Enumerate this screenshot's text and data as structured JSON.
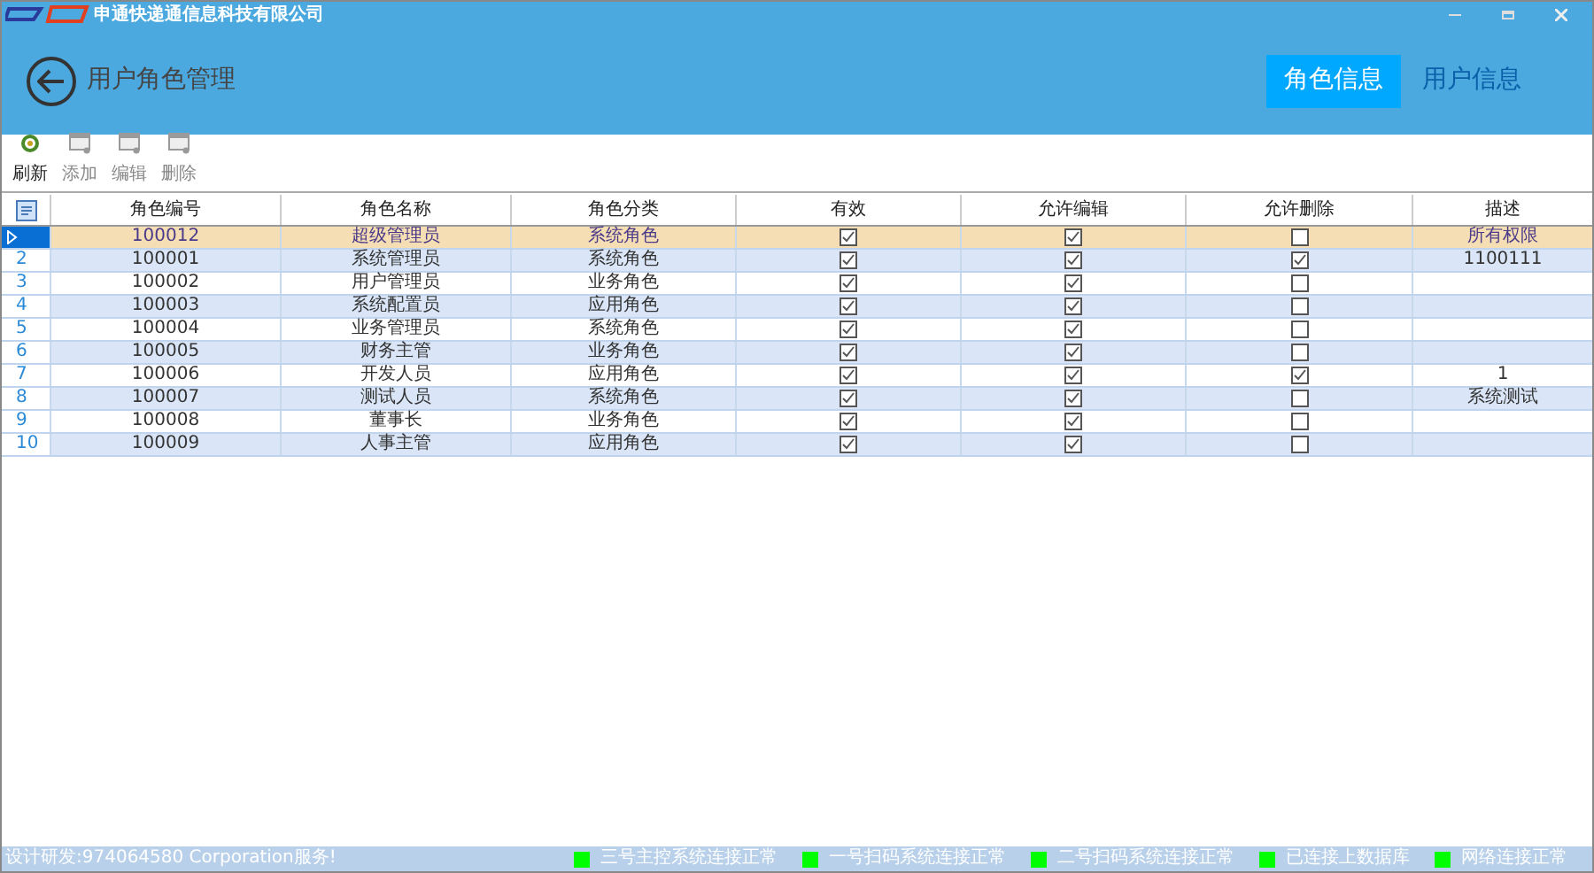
{
  "window": {
    "title": "申通快递通信息科技有限公司"
  },
  "header": {
    "title": "用户角色管理",
    "tabs": [
      {
        "label": "角色信息",
        "selected": true
      },
      {
        "label": "用户信息",
        "selected": false
      }
    ]
  },
  "toolbar": [
    {
      "label": "刷新",
      "kind": "refresh",
      "disabled": false
    },
    {
      "label": "添加",
      "kind": "add",
      "disabled": true
    },
    {
      "label": "编辑",
      "kind": "edit",
      "disabled": true
    },
    {
      "label": "删除",
      "kind": "delete",
      "disabled": true
    }
  ],
  "table": {
    "columns": [
      "角色编号",
      "角色名称",
      "角色分类",
      "有效",
      "允许编辑",
      "允许删除",
      "描述"
    ],
    "rows": [
      {
        "row_number": "",
        "selected": true,
        "id": "100012",
        "name": "超级管理员",
        "category": "系统角色",
        "valid": true,
        "editable": true,
        "deletable": false,
        "description": "所有权限"
      },
      {
        "row_number": "2",
        "selected": false,
        "id": "100001",
        "name": "系统管理员",
        "category": "系统角色",
        "valid": true,
        "editable": true,
        "deletable": true,
        "description": "1100111"
      },
      {
        "row_number": "3",
        "selected": false,
        "id": "100002",
        "name": "用户管理员",
        "category": "业务角色",
        "valid": true,
        "editable": true,
        "deletable": false,
        "description": ""
      },
      {
        "row_number": "4",
        "selected": false,
        "id": "100003",
        "name": "系统配置员",
        "category": "应用角色",
        "valid": true,
        "editable": true,
        "deletable": false,
        "description": ""
      },
      {
        "row_number": "5",
        "selected": false,
        "id": "100004",
        "name": "业务管理员",
        "category": "系统角色",
        "valid": true,
        "editable": true,
        "deletable": false,
        "description": ""
      },
      {
        "row_number": "6",
        "selected": false,
        "id": "100005",
        "name": "财务主管",
        "category": "业务角色",
        "valid": true,
        "editable": true,
        "deletable": false,
        "description": ""
      },
      {
        "row_number": "7",
        "selected": false,
        "id": "100006",
        "name": "开发人员",
        "category": "应用角色",
        "valid": true,
        "editable": true,
        "deletable": true,
        "description": "1"
      },
      {
        "row_number": "8",
        "selected": false,
        "id": "100007",
        "name": "测试人员",
        "category": "系统角色",
        "valid": true,
        "editable": true,
        "deletable": false,
        "description": "系统测试"
      },
      {
        "row_number": "9",
        "selected": false,
        "id": "100008",
        "name": "董事长",
        "category": "业务角色",
        "valid": true,
        "editable": true,
        "deletable": false,
        "description": ""
      },
      {
        "row_number": "10",
        "selected": false,
        "id": "100009",
        "name": "人事主管",
        "category": "应用角色",
        "valid": true,
        "editable": true,
        "deletable": false,
        "description": ""
      }
    ]
  },
  "status_bar": {
    "text": "设计研发:974064580 Corporation服务!",
    "indicators": [
      {
        "label": "三号主控系统连接正常",
        "color": "#00ff00"
      },
      {
        "label": "一号扫码系统连接正常",
        "color": "#00ff00"
      },
      {
        "label": "二号扫码系统连接正常",
        "color": "#00ff00"
      },
      {
        "label": "已连接上数据库",
        "color": "#00ff00"
      },
      {
        "label": "网络连接正常",
        "color": "#00ff00"
      }
    ]
  }
}
